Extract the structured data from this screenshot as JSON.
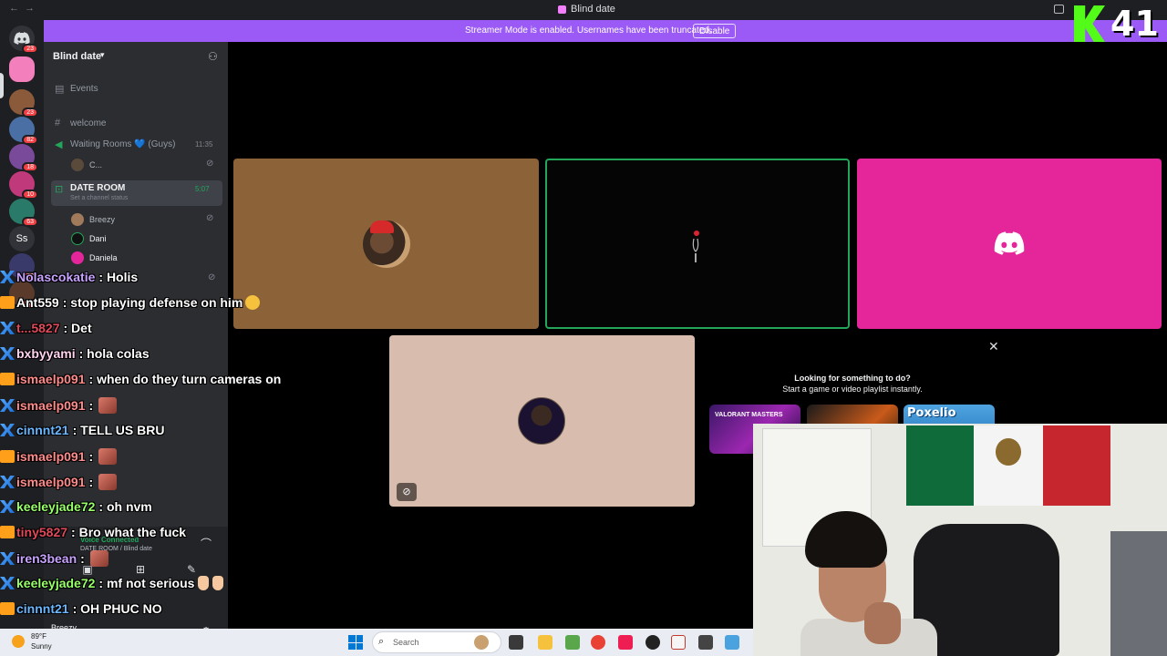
{
  "titlebar": {
    "title": "Blind date"
  },
  "banner": {
    "text": "Streamer Mode is enabled. Usernames have been truncated.",
    "button": "Disable"
  },
  "overlay_counter": "41",
  "rail": {
    "servers": [
      {
        "badge": "23"
      },
      {
        "badge": ""
      },
      {
        "badge": "23"
      },
      {
        "badge": "82"
      },
      {
        "badge": "18"
      },
      {
        "badge": "10"
      },
      {
        "badge": "63"
      },
      {
        "label": "Ss"
      },
      {
        "badge": "39"
      },
      {
        "badge": "60"
      }
    ]
  },
  "sidebar": {
    "server_name": "Blind date",
    "channels": {
      "events": "Events",
      "welcome": "welcome",
      "waiting_room": "Waiting Rooms 💙 (Guys)",
      "waiting_room_time": "11:35",
      "waiting_room_user": "C...",
      "date_room": "DATE ROOM",
      "date_room_status": "Set a channel status",
      "date_room_time": "5:07"
    },
    "voice_users": [
      {
        "name": "Breezy"
      },
      {
        "name": "Dani"
      },
      {
        "name": "Daniela"
      }
    ]
  },
  "voice_panel": {
    "status": "Voice Connected",
    "location": "DATE ROOM / Blind date",
    "user": "Breezy"
  },
  "promo": {
    "line1": "Looking for something to do?",
    "line2": "Start a game or video playlist instantly.",
    "card1": "VALORANT MASTERS",
    "card3": "Poxelio"
  },
  "chat": [
    {
      "user": "Nolascokatie",
      "msg": "Holis",
      "color": "#c8a2ff"
    },
    {
      "user": "Ant559",
      "msg": "stop playing defense on him",
      "color": "#ffffff",
      "emoji": true
    },
    {
      "user": "t...5827",
      "msg": "Det",
      "color": "#e04a5a"
    },
    {
      "user": "bxbyyami",
      "msg": "hola colas",
      "color": "#ffd3f0"
    },
    {
      "user": "ismaelp091",
      "msg": "when do they turn cameras on",
      "color": "#ff8a8a"
    },
    {
      "user": "ismaelp091",
      "msg": "",
      "color": "#ff8a8a",
      "emote": true
    },
    {
      "user": "cinnnt21",
      "msg": "TELL US BRU",
      "color": "#6ab7ff"
    },
    {
      "user": "ismaelp091",
      "msg": "",
      "color": "#ff8a8a",
      "emote": true
    },
    {
      "user": "ismaelp091",
      "msg": "",
      "color": "#ff8a8a",
      "emote": true
    },
    {
      "user": "keeleyjade72",
      "msg": "oh nvm",
      "color": "#98ff6a"
    },
    {
      "user": "tiny5827",
      "msg": "Bro what the fuck",
      "color": "#e04a5a"
    },
    {
      "user": "iren3bean",
      "msg": "",
      "color": "#c8a2ff",
      "emote": true
    },
    {
      "user": "keeleyjade72",
      "msg": "mf not serious",
      "color": "#98ff6a",
      "hands": true
    },
    {
      "user": "cinnnt21",
      "msg": "OH PHUC NO",
      "color": "#6ab7ff"
    }
  ],
  "taskbar": {
    "temp": "89°F",
    "condition": "Sunny",
    "search_placeholder": "Search"
  }
}
